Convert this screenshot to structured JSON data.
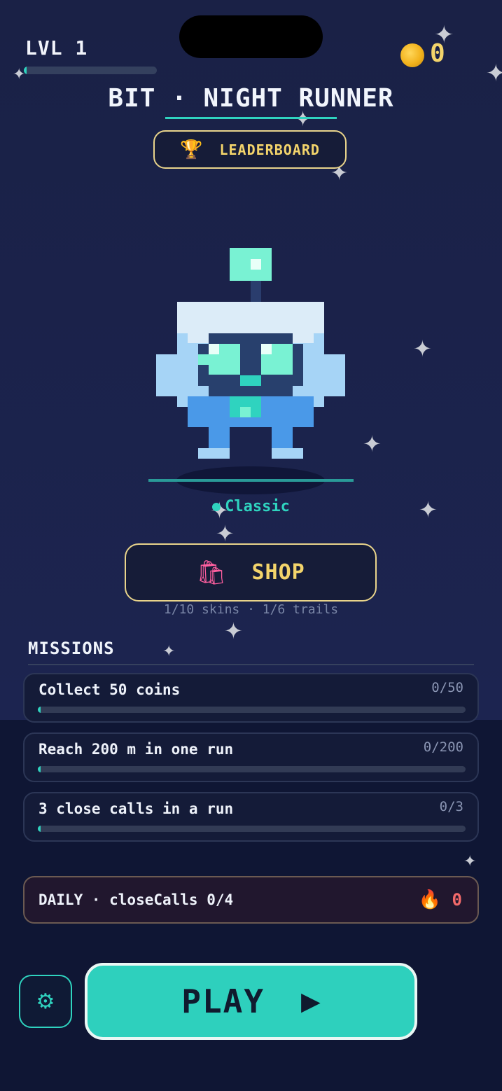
{
  "header": {
    "level_label": "LVL 1",
    "xp_progress": 0.02,
    "coin_icon": "coin-icon",
    "coin_count": "0"
  },
  "title": "BIT · NIGHT RUNNER",
  "leaderboard": {
    "icon": "trophy-icon",
    "label": "LEADERBOARD"
  },
  "character": {
    "skin_name": "Classic",
    "accent": "#2fd3bf"
  },
  "shop": {
    "icon": "shopping-bag-icon",
    "label": "SHOP",
    "subtitle": "1/10 skins · 1/6 trails"
  },
  "missions": {
    "title": "MISSIONS",
    "items": [
      {
        "label": "Collect 50 coins",
        "progress_text": "0/50",
        "progress": 0.0
      },
      {
        "label": "Reach 200 m in one run",
        "progress_text": "0/200",
        "progress": 0.0
      },
      {
        "label": "3 close calls in a run",
        "progress_text": "0/3",
        "progress": 0.0
      }
    ]
  },
  "daily": {
    "label": "DAILY · closeCalls 0/4",
    "icon": "fire-icon",
    "streak": "0"
  },
  "footer": {
    "settings_icon": "gear-icon",
    "play_label": "PLAY",
    "play_icon": "play-triangle-icon"
  },
  "colors": {
    "accent": "#2fd3bf",
    "gold": "#f3d46b",
    "background": "#1b2247"
  }
}
